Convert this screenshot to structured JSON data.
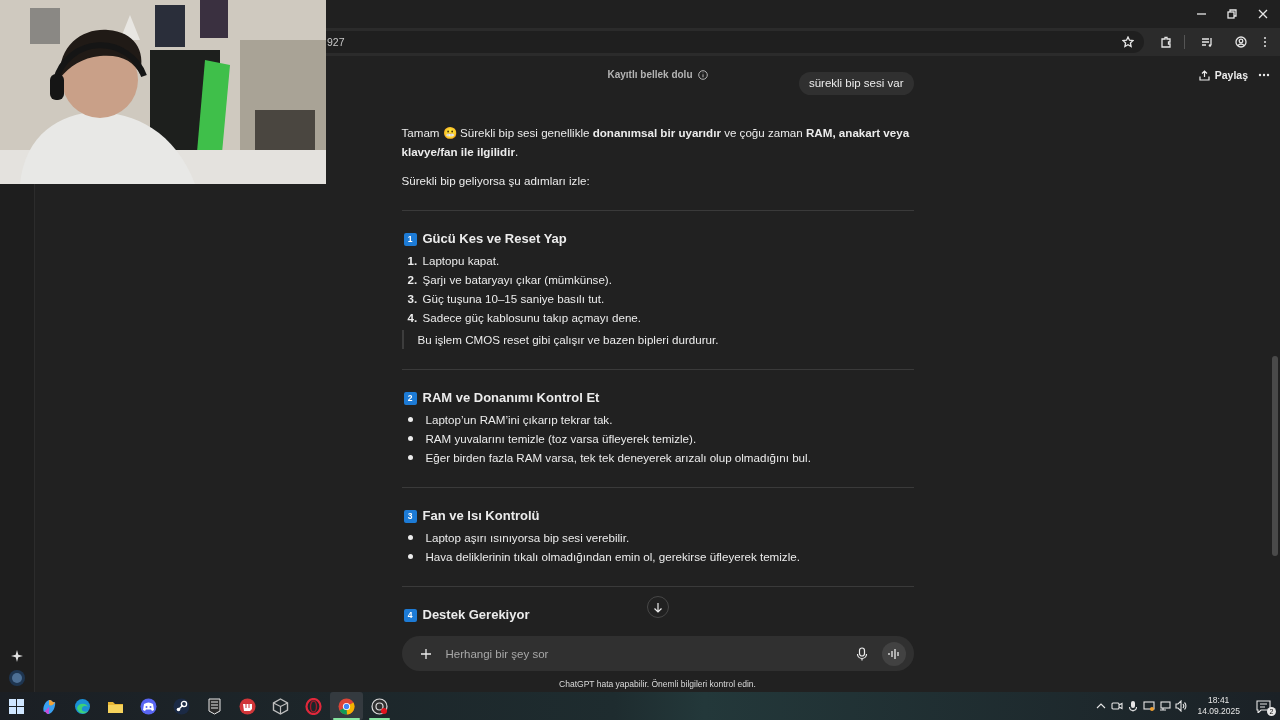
{
  "browser": {
    "address_text": "927"
  },
  "header": {
    "memory_notice": "Kayıtlı bellek dolu",
    "share_label": "Paylaş"
  },
  "user_message": "sürekli bip sesi var",
  "answer": {
    "intro": "Tamam 😬 Sürekli bip sesi genellikle **donanımsal bir uyarıdır** ve çoğu zaman **RAM, anakart veya klavye/fan ile ilgilidir**.",
    "lead_in": "Sürekli bip geliyorsa şu adımları izle:",
    "sections": [
      {
        "number": "1",
        "title": "Gücü Kes ve Reset Yap",
        "kind": "ordered",
        "items": [
          {
            "marker": "1.",
            "text": "Laptopu kapat."
          },
          {
            "marker": "2.",
            "text": "Şarjı ve bataryayı çıkar (mümkünse)."
          },
          {
            "marker": "3.",
            "text": "Güç tuşuna 10–15 saniye basılı tut."
          },
          {
            "marker": "4.",
            "text": "Sadece güç kablosunu takıp açmayı dene."
          }
        ],
        "note": "Bu işlem CMOS reset gibi çalışır ve bazen bipleri durdurur."
      },
      {
        "number": "2",
        "title": "RAM ve Donanımı Kontrol Et",
        "kind": "bullet",
        "items": [
          {
            "text": "Laptop’un RAM’ini çıkarıp tekrar tak."
          },
          {
            "text": "RAM yuvalarını temizle (toz varsa üfleyerek temizle)."
          },
          {
            "text": "Eğer birden fazla RAM varsa, tek tek deneyerek arızalı olup olmadığını bul."
          }
        ]
      },
      {
        "number": "3",
        "title": "Fan ve Isı Kontrolü",
        "kind": "bullet",
        "items": [
          {
            "text": "Laptop aşırı ısınıyorsa bip sesi verebilir."
          },
          {
            "text": "Hava deliklerinin tıkalı olmadığından emin ol, gerekirse üfleyerek temizle."
          }
        ]
      },
      {
        "number": "4",
        "title": "Destek Gerekiyor"
      }
    ]
  },
  "composer": {
    "placeholder": "Herhangi bir şey sor"
  },
  "disclaimer": "ChatGPT hata yapabilir. Önemli bilgileri kontrol edin.",
  "taskbar": {
    "apps": [
      {
        "kind": "start",
        "selected": false,
        "running": false
      },
      {
        "kind": "swirl",
        "selected": false,
        "running": false
      },
      {
        "kind": "wave",
        "selected": false,
        "running": false
      },
      {
        "kind": "folder",
        "selected": false,
        "running": false
      },
      {
        "kind": "controller",
        "selected": false,
        "running": false
      },
      {
        "kind": "piston",
        "selected": false,
        "running": false
      },
      {
        "kind": "shield",
        "selected": false,
        "running": false
      },
      {
        "kind": "fist",
        "selected": false,
        "running": false
      },
      {
        "kind": "cube",
        "selected": false,
        "running": false
      },
      {
        "kind": "ring",
        "selected": false,
        "running": false
      },
      {
        "kind": "chrome",
        "selected": true,
        "running": true
      },
      {
        "kind": "recorder",
        "selected": false,
        "running": true
      }
    ],
    "time": "18:41",
    "date": "14.09.2025",
    "notification_count": "2"
  }
}
